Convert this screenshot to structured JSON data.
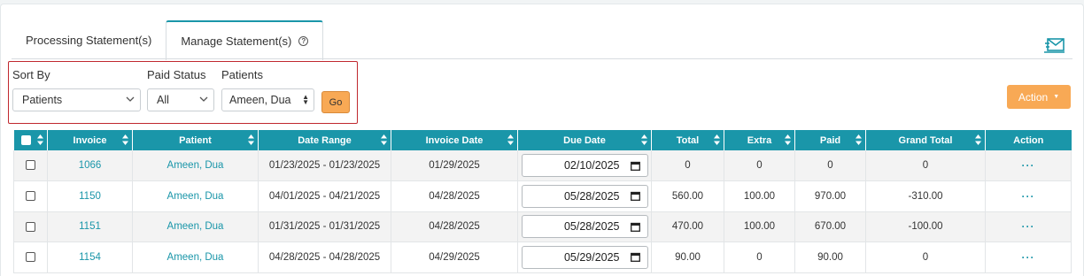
{
  "tabs": [
    {
      "label": "Processing Statement(s)"
    },
    {
      "label": "Manage Statement(s)",
      "help_icon": "?"
    }
  ],
  "filters": {
    "sort_by_label": "Sort By",
    "sort_by_value": "Patients",
    "paid_status_label": "Paid Status",
    "paid_status_value": "All",
    "patients_label": "Patients",
    "patients_value": "Ameen, Dua",
    "go_label": "Go"
  },
  "action_button_label": "Action",
  "table": {
    "headers": [
      "Invoice",
      "Patient",
      "Date Range",
      "Invoice Date",
      "Due Date",
      "Total",
      "Extra",
      "Paid",
      "Grand Total",
      "Action"
    ],
    "rows": [
      {
        "invoice": "1066",
        "patient": "Ameen, Dua",
        "date_range": "01/23/2025 - 01/23/2025",
        "invoice_date": "01/29/2025",
        "due_date": "02/10/2025",
        "total": "0",
        "extra": "0",
        "paid": "0",
        "grand_total": "0",
        "action": "···"
      },
      {
        "invoice": "1150",
        "patient": "Ameen, Dua",
        "date_range": "04/01/2025 - 04/21/2025",
        "invoice_date": "04/28/2025",
        "due_date": "05/28/2025",
        "total": "560.00",
        "extra": "100.00",
        "paid": "970.00",
        "grand_total": "-310.00",
        "action": "···"
      },
      {
        "invoice": "1151",
        "patient": "Ameen, Dua",
        "date_range": "01/31/2025 - 01/31/2025",
        "invoice_date": "04/28/2025",
        "due_date": "05/28/2025",
        "total": "470.00",
        "extra": "100.00",
        "paid": "670.00",
        "grand_total": "-100.00",
        "action": "···"
      },
      {
        "invoice": "1154",
        "patient": "Ameen, Dua",
        "date_range": "04/28/2025 - 04/28/2025",
        "invoice_date": "04/29/2025",
        "due_date": "05/29/2025",
        "total": "90.00",
        "extra": "0",
        "paid": "90.00",
        "grand_total": "0",
        "action": "···"
      }
    ]
  },
  "colors": {
    "accent": "#1a96a9",
    "orange": "#f8a955",
    "highlight_border": "#c0282f"
  },
  "icons": {
    "mail": "mail-send-icon",
    "help": "help-circle-icon",
    "calendar": "calendar-icon"
  }
}
